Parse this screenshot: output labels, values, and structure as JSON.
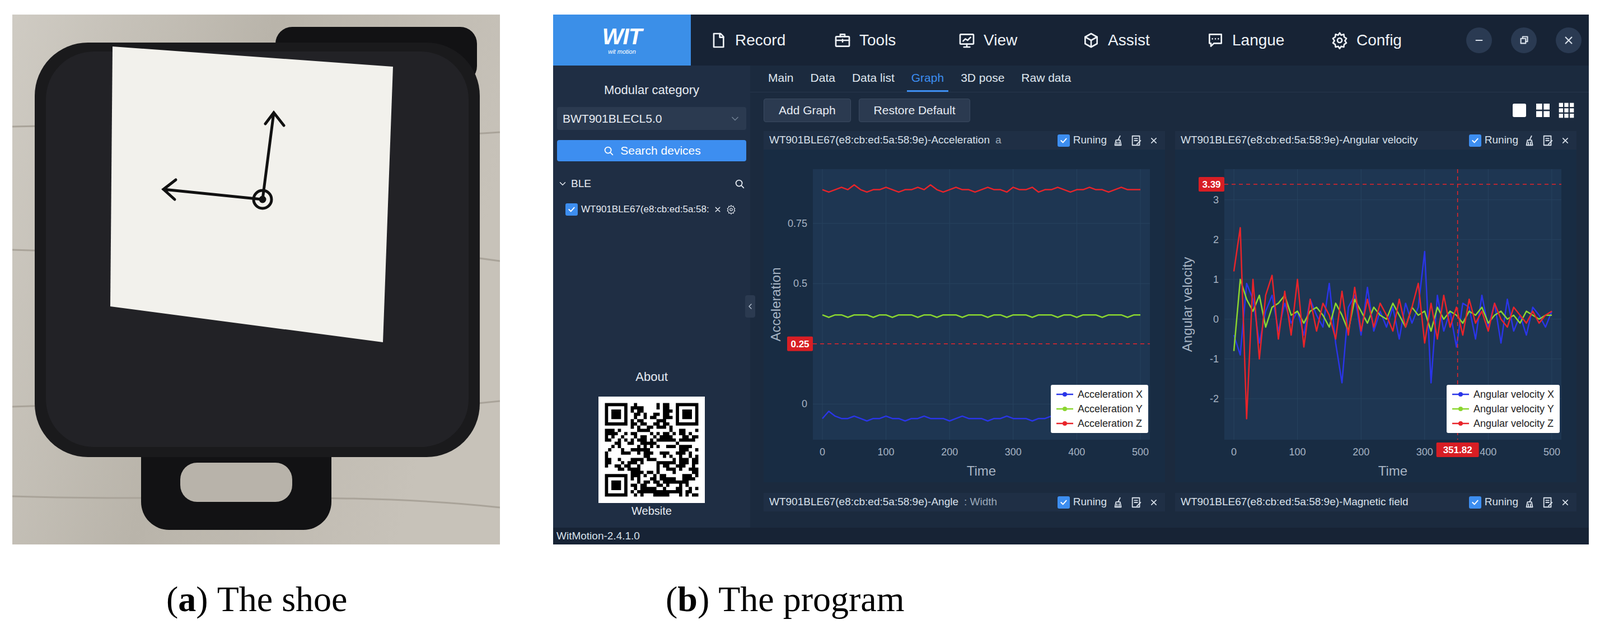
{
  "captions": [
    {
      "open": "(",
      "label": "a",
      "close": ")",
      "text": "The shoe"
    },
    {
      "open": "(",
      "label": "b",
      "close": ")",
      "text": "The program"
    }
  ],
  "app": {
    "logo": {
      "main": "WIT",
      "sub": "wit motion"
    },
    "menu": [
      "Record",
      "Tools",
      "View",
      "Assist",
      "Langue",
      "Config"
    ],
    "sidebar": {
      "heading": "Modular category",
      "dropdown": "BWT901BLECL5.0",
      "search_button": "Search devices",
      "group": {
        "label": "BLE",
        "expanded": true
      },
      "devices": [
        {
          "label": "WT901BLE67(e8:cb:ed:5a:58:",
          "checked": true
        }
      ],
      "about": "About",
      "website": "Website"
    },
    "tabs": [
      {
        "label": "Main",
        "selected": false
      },
      {
        "label": "Data",
        "selected": false
      },
      {
        "label": "Data list",
        "selected": false
      },
      {
        "label": "Graph",
        "selected": true
      },
      {
        "label": "3D pose",
        "selected": false
      },
      {
        "label": "Raw data",
        "selected": false
      }
    ],
    "toolbar": {
      "buttons": [
        "Add Graph",
        "Restore Default"
      ]
    },
    "panels": [
      {
        "title": "WT901BLE67(e8:cb:ed:5a:58:9e)-Acceleration",
        "extra": "a",
        "running_label": "Runing",
        "running": true,
        "chart": {
          "y_label": "Acceleration",
          "x_label": "Time",
          "y_range": [
            -0.148,
            0.975
          ],
          "x_range": [
            -15,
            515
          ],
          "x_step": 10,
          "y_ticks": [
            {
              "label": "0",
              "value": 0
            },
            {
              "label": "0.5",
              "value": 0.5
            },
            {
              "label": "0.75",
              "value": 0.75
            }
          ],
          "x_ticks": [
            {
              "label": "0",
              "value": 0
            },
            {
              "label": "100",
              "value": 100
            },
            {
              "label": "200",
              "value": 200
            },
            {
              "label": "300",
              "value": 300
            },
            {
              "label": "400",
              "value": 400
            },
            {
              "label": "500",
              "value": 500
            }
          ],
          "markers": [
            {
              "axis": "y",
              "label": "0.25",
              "value": 0.25
            }
          ],
          "series": [
            {
              "name": "Acceleration X",
              "color": "#2a35e8",
              "values": [
                -0.06,
                -0.03,
                -0.05,
                -0.06,
                -0.06,
                -0.05,
                -0.06,
                -0.07,
                -0.06,
                -0.06,
                -0.05,
                -0.06,
                -0.06,
                -0.07,
                -0.06,
                -0.06,
                -0.05,
                -0.06,
                -0.06,
                -0.06,
                -0.07,
                -0.06,
                -0.05,
                -0.06,
                -0.06,
                -0.06,
                -0.07,
                -0.06,
                -0.06,
                -0.05,
                -0.06,
                -0.06,
                -0.06,
                -0.07,
                -0.06,
                -0.06,
                -0.05,
                -0.06,
                -0.06,
                -0.06,
                -0.07,
                -0.06,
                -0.06,
                -0.05,
                -0.06,
                -0.06,
                -0.06,
                -0.06,
                -0.07,
                -0.06,
                -0.06
              ]
            },
            {
              "name": "Acceleration Y",
              "color": "#8bd62f",
              "values": [
                0.37,
                0.36,
                0.37,
                0.37,
                0.36,
                0.37,
                0.37,
                0.37,
                0.36,
                0.37,
                0.37,
                0.36,
                0.37,
                0.37,
                0.37,
                0.36,
                0.37,
                0.37,
                0.36,
                0.37,
                0.37,
                0.37,
                0.36,
                0.37,
                0.37,
                0.37,
                0.36,
                0.37,
                0.37,
                0.36,
                0.37,
                0.37,
                0.37,
                0.36,
                0.37,
                0.37,
                0.37,
                0.36,
                0.37,
                0.37,
                0.36,
                0.37,
                0.37,
                0.37,
                0.36,
                0.37,
                0.37,
                0.37,
                0.36,
                0.37,
                0.37
              ]
            },
            {
              "name": "Acceleration Z",
              "color": "#e8242a",
              "values": [
                0.89,
                0.88,
                0.89,
                0.9,
                0.89,
                0.91,
                0.89,
                0.88,
                0.89,
                0.89,
                0.9,
                0.89,
                0.88,
                0.89,
                0.89,
                0.9,
                0.89,
                0.91,
                0.89,
                0.88,
                0.89,
                0.9,
                0.89,
                0.89,
                0.88,
                0.89,
                0.9,
                0.89,
                0.89,
                0.88,
                0.9,
                0.89,
                0.89,
                0.9,
                0.88,
                0.89,
                0.89,
                0.9,
                0.89,
                0.88,
                0.89,
                0.89,
                0.9,
                0.89,
                0.89,
                0.88,
                0.89,
                0.9,
                0.89,
                0.89,
                0.89
              ]
            }
          ]
        }
      },
      {
        "title": "WT901BLE67(e8:cb:ed:5a:58:9e)-Angular velocity",
        "running_label": "Runing",
        "running": true,
        "chart": {
          "y_label": "Angular velocity",
          "x_label": "Time",
          "y_range": [
            -3.03,
            3.77
          ],
          "x_range": [
            -15,
            515
          ],
          "x_step": 10,
          "y_ticks": [
            {
              "label": "-2",
              "value": -2
            },
            {
              "label": "-1",
              "value": -1
            },
            {
              "label": "0",
              "value": 0
            },
            {
              "label": "1",
              "value": 1
            },
            {
              "label": "2",
              "value": 2
            },
            {
              "label": "3",
              "value": 3
            }
          ],
          "x_ticks": [
            {
              "label": "0",
              "value": 0
            },
            {
              "label": "100",
              "value": 100
            },
            {
              "label": "200",
              "value": 200
            },
            {
              "label": "300",
              "value": 300
            },
            {
              "label": "400",
              "value": 400
            },
            {
              "label": "500",
              "value": 500
            }
          ],
          "markers": [
            {
              "axis": "y",
              "label": "3.39",
              "value": 3.39
            },
            {
              "axis": "x",
              "label": "351.82",
              "value": 351.82
            }
          ],
          "series": [
            {
              "name": "Angular velocity X",
              "color": "#2a35e8",
              "values": [
                -0.4,
                -0.9,
                0.9,
                0.5,
                -0.6,
                0.2,
                0.6,
                -0.3,
                0.4,
                -0.1,
                0.2,
                -0.4,
                0.5,
                0.1,
                -0.2,
                0.9,
                -0.6,
                -1.6,
                0.3,
                0.6,
                -0.4,
                0.8,
                -0.3,
                0.2,
                -0.2,
                0.3,
                -0.5,
                0.4,
                -0.1,
                0.3,
                1.7,
                -1.6,
                0.6,
                -0.3,
                0.2,
                -0.7,
                0.4,
                0.3,
                -0.5,
                0.6,
                -0.2,
                0.4,
                -0.6,
                0.5,
                -0.3,
                0.1,
                -0.4,
                0.3,
                0.1,
                -0.2,
                0.2
              ]
            },
            {
              "name": "Angular velocity Y",
              "color": "#8bd62f",
              "values": [
                -0.8,
                1.0,
                0.5,
                0.2,
                0.6,
                -0.2,
                0.3,
                0.4,
                0.6,
                0.1,
                0.2,
                -0.1,
                0.2,
                0.3,
                0.1,
                -0.2,
                0.4,
                0.1,
                -0.3,
                0.5,
                0.2,
                -0.1,
                0.3,
                0.1,
                0.0,
                0.4,
                0.1,
                -0.2,
                0.3,
                0.1,
                0.2,
                -0.3,
                0.3,
                0.0,
                0.2,
                0.1,
                -0.1,
                0.2,
                0.1,
                0.3,
                -0.1,
                0.1,
                0.2,
                0.0,
                0.1,
                -0.1,
                0.2,
                0.1,
                0.0,
                0.1,
                0.1
              ]
            },
            {
              "name": "Angular velocity Z",
              "color": "#e8242a",
              "values": [
                1.2,
                2.3,
                -2.5,
                1.0,
                -1.0,
                0.6,
                1.1,
                -0.5,
                0.7,
                -0.4,
                1.0,
                -0.7,
                0.5,
                -0.3,
                0.4,
                0.1,
                -0.5,
                0.7,
                -0.4,
                0.8,
                -0.3,
                0.5,
                -0.2,
                0.4,
                0.1,
                -0.3,
                0.5,
                -0.2,
                0.3,
                0.9,
                -0.6,
                0.4,
                -0.5,
                0.6,
                -0.2,
                0.3,
                -0.4,
                0.5,
                -0.1,
                0.2,
                -0.3,
                0.4,
                0.0,
                -0.2,
                0.3,
                0.1,
                -0.1,
                0.2,
                -0.1,
                0.1,
                0.2
              ]
            }
          ]
        }
      },
      {
        "title": "WT901BLE67(e8:cb:ed:5a:58:9e)-Angle",
        "extra": ": Width",
        "running_label": "Runing",
        "running": true
      },
      {
        "title": "WT901BLE67(e8:cb:ed:5a:58:9e)-Magnetic field",
        "running_label": "Runing",
        "running": true
      }
    ],
    "status_bar": "WitMotion-2.4.1.0"
  }
}
